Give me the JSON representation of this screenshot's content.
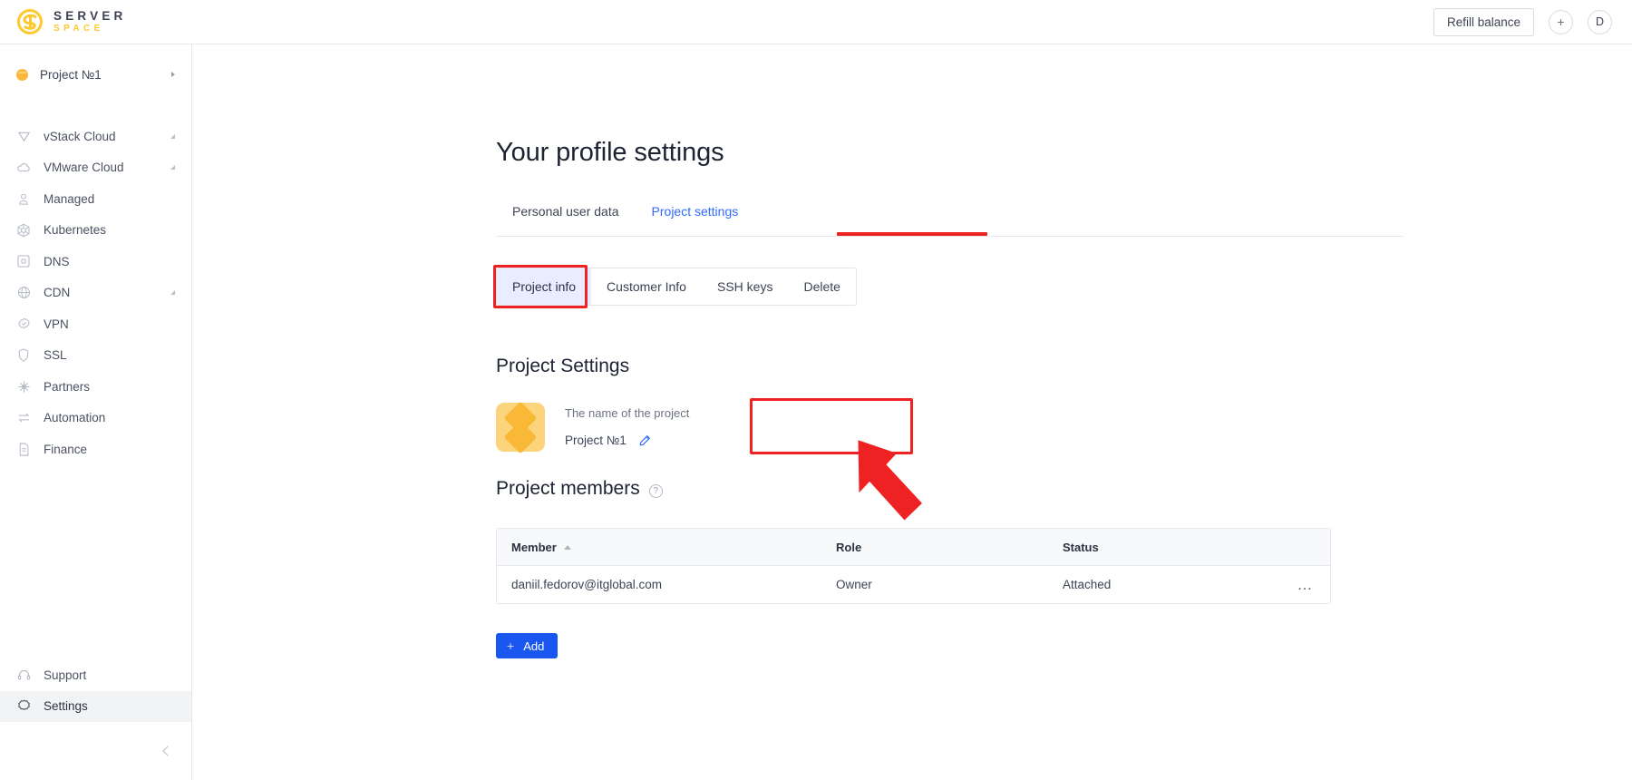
{
  "brand": {
    "line1": "SERVER",
    "line2": "SPACE",
    "logo_color": "#fdc92f"
  },
  "header": {
    "refill_label": "Refill balance",
    "add_icon": "+",
    "avatar_initial": "D"
  },
  "sidebar": {
    "project": {
      "name": "Project №1",
      "chevron": "caret-right-icon"
    },
    "items": [
      {
        "label": "vStack Cloud",
        "icon": "vstack-icon",
        "expandable": true
      },
      {
        "label": "VMware Cloud",
        "icon": "cloud-icon",
        "expandable": true
      },
      {
        "label": "Managed",
        "icon": "person-icon",
        "expandable": false
      },
      {
        "label": "Kubernetes",
        "icon": "kubernetes-icon",
        "expandable": false
      },
      {
        "label": "DNS",
        "icon": "dns-icon",
        "expandable": false
      },
      {
        "label": "CDN",
        "icon": "globe-icon",
        "expandable": true
      },
      {
        "label": "VPN",
        "icon": "vpn-badge-icon",
        "expandable": false
      },
      {
        "label": "SSL",
        "icon": "shield-icon",
        "expandable": false
      },
      {
        "label": "Partners",
        "icon": "partners-icon",
        "expandable": false
      },
      {
        "label": "Automation",
        "icon": "automation-icon",
        "expandable": false
      },
      {
        "label": "Finance",
        "icon": "document-icon",
        "expandable": false
      }
    ],
    "bottom_items": [
      {
        "label": "Support",
        "icon": "headset-icon",
        "active": false
      },
      {
        "label": "Settings",
        "icon": "gear-icon",
        "active": true
      }
    ]
  },
  "main": {
    "page_title": "Your profile settings",
    "tabs": [
      {
        "label": "Personal user data",
        "active": false
      },
      {
        "label": "Project settings",
        "active": true
      }
    ],
    "segmented": [
      {
        "label": "Project info",
        "active": true
      },
      {
        "label": "Customer Info",
        "active": false
      },
      {
        "label": "SSH keys",
        "active": false
      },
      {
        "label": "Delete",
        "active": false
      }
    ],
    "project_settings": {
      "section_title": "Project Settings",
      "avatar_icon": "project-diamond-avatar",
      "name_label": "The name of the project",
      "name_value": "Project №1",
      "edit_icon": "pencil-icon"
    },
    "members": {
      "section_title": "Project members",
      "help_icon": "question-mark-icon",
      "columns": [
        "Member",
        "Role",
        "Status"
      ],
      "sort_column": "Member",
      "sort_direction": "asc",
      "rows": [
        {
          "member": "daniil.fedorov@itglobal.com",
          "role": "Owner",
          "status": "Attached",
          "menu": "…"
        }
      ],
      "add_label": "Add",
      "add_icon": "+"
    }
  },
  "annotations": {
    "accent_color": "#ee2222",
    "tab_underline": "red-underline-project-settings",
    "segmented_box": "red-box-project-info",
    "name_box": "red-box-project-name",
    "arrow": "red-arrow-pointing-to-project-name"
  }
}
